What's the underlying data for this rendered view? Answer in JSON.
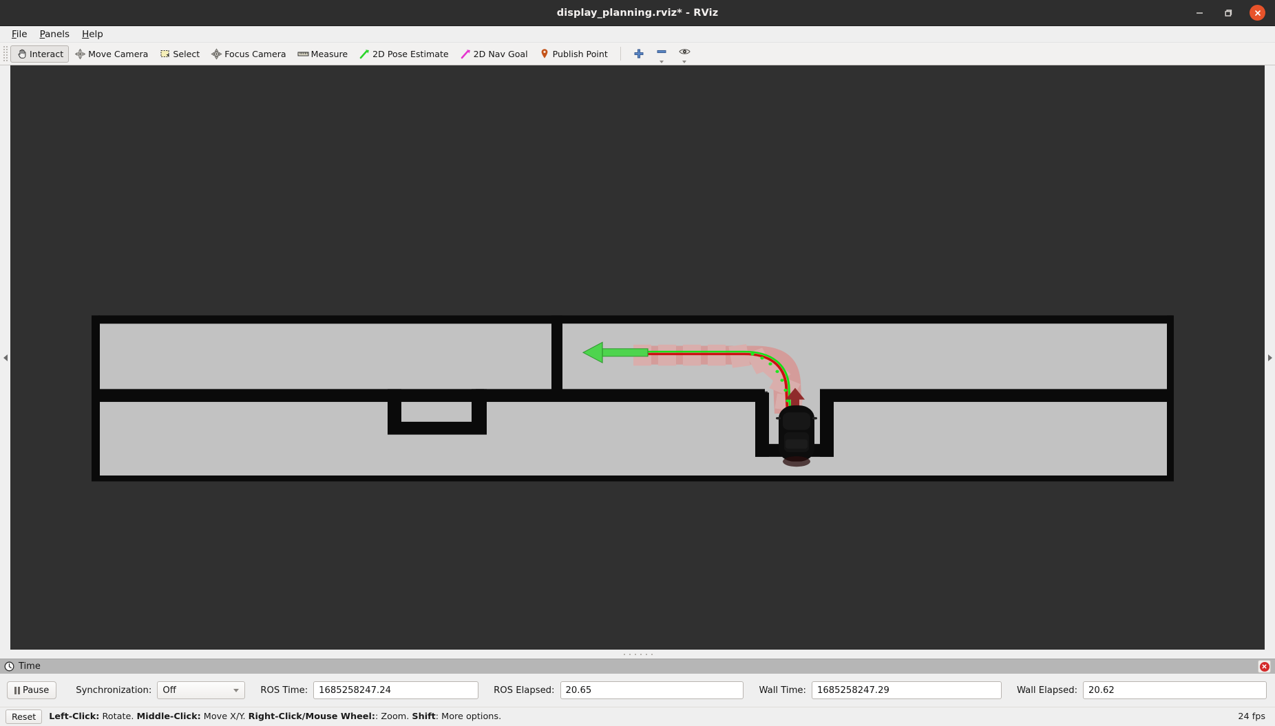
{
  "window": {
    "title": "display_planning.rviz* - RViz",
    "controls": [
      {
        "name": "minimize",
        "glyph": "minimize-icon"
      },
      {
        "name": "maximize",
        "glyph": "maximize-icon"
      },
      {
        "name": "close",
        "glyph": "close-icon"
      }
    ]
  },
  "menubar": {
    "items": [
      {
        "label": "File",
        "mnemonic": "F"
      },
      {
        "label": "Panels",
        "mnemonic": "P"
      },
      {
        "label": "Help",
        "mnemonic": "H"
      }
    ]
  },
  "toolbar": {
    "buttons": [
      {
        "label": "Interact",
        "icon": "hand-cursor-icon",
        "active": true
      },
      {
        "label": "Move Camera",
        "icon": "move-camera-icon",
        "active": false
      },
      {
        "label": "Select",
        "icon": "select-rectangle-icon",
        "active": false
      },
      {
        "label": "Focus Camera",
        "icon": "focus-camera-icon",
        "active": false
      },
      {
        "label": "Measure",
        "icon": "ruler-icon",
        "active": false
      },
      {
        "label": "2D Pose Estimate",
        "icon": "green-arrow-icon",
        "active": false
      },
      {
        "label": "2D Nav Goal",
        "icon": "magenta-arrow-icon",
        "active": false
      },
      {
        "label": "Publish Point",
        "icon": "map-pin-icon",
        "active": false
      }
    ],
    "tools_right": [
      {
        "name": "add-tool",
        "icon": "plus-icon"
      },
      {
        "name": "remove-tool",
        "icon": "minus-icon"
      },
      {
        "name": "visibility-tool",
        "icon": "eye-icon"
      }
    ]
  },
  "viewport": {
    "background_color": "#303030",
    "free_space_color": "#c2c2c2",
    "obstacle_color": "#0a0a0a",
    "path_color": "#15e015",
    "centerline_color": "#cc1111",
    "footprint_color": "#e8736f",
    "goal_arrow_color": "#4ed44e",
    "heading_arrow_color": "#8f2b2b",
    "vehicle_color": "#0d0d0d",
    "left_handle": "collapse-left-icon",
    "right_handle": "collapse-right-icon"
  },
  "time_panel": {
    "title": "Time",
    "icon": "clock-icon",
    "close_icon": "close-panel-icon",
    "pause_label": "Pause",
    "fields": [
      {
        "label": "Synchronization:",
        "type": "combo",
        "value": "Off"
      },
      {
        "label": "ROS Time:",
        "type": "text",
        "value": "1685258247.24"
      },
      {
        "label": "ROS Elapsed:",
        "type": "text",
        "value": "20.65"
      },
      {
        "label": "Wall Time:",
        "type": "text",
        "value": "1685258247.29"
      },
      {
        "label": "Wall Elapsed:",
        "type": "text",
        "value": "20.62"
      }
    ]
  },
  "statusbar": {
    "reset_label": "Reset",
    "hint_parts": [
      {
        "text": "Left-Click:",
        "bold": true
      },
      {
        "text": " Rotate. ",
        "bold": false
      },
      {
        "text": "Middle-Click:",
        "bold": true
      },
      {
        "text": " Move X/Y. ",
        "bold": false
      },
      {
        "text": "Right-Click/Mouse Wheel:",
        "bold": true
      },
      {
        "text": ": Zoom. ",
        "bold": false
      },
      {
        "text": "Shift",
        "bold": true
      },
      {
        "text": ": More options.",
        "bold": false
      }
    ],
    "fps": "24 fps"
  }
}
